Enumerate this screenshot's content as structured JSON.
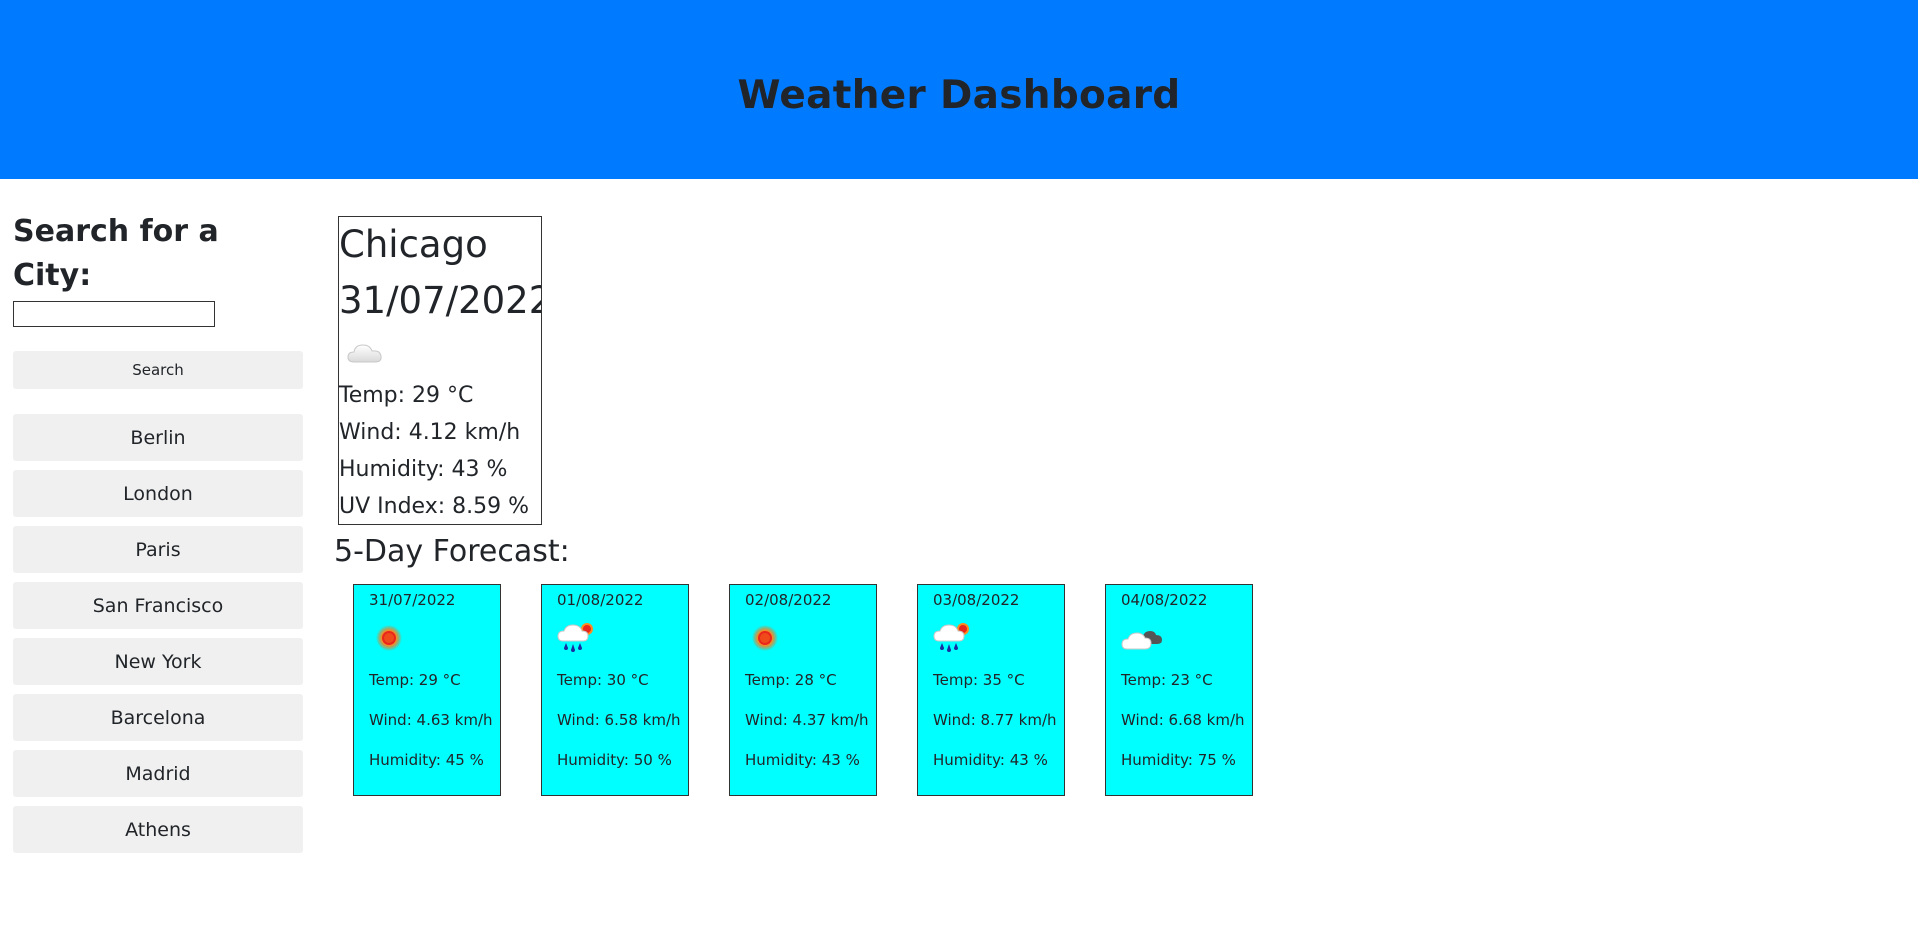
{
  "header": {
    "title": "Weather Dashboard"
  },
  "sidebar": {
    "heading": "Search for a City:",
    "search_value": "",
    "search_button": "Search",
    "history": [
      "Berlin",
      "London",
      "Paris",
      "San Francisco",
      "New York",
      "Barcelona",
      "Madrid",
      "Athens"
    ]
  },
  "current": {
    "city": "Chicago",
    "date": "31/07/2022",
    "icon": "cloud-icon",
    "temp": "Temp: 29 °C",
    "wind": "Wind: 4.12 km/h",
    "humidity": "Humidity: 43 %",
    "uv": "UV Index: 8.59 %"
  },
  "forecast": {
    "title": "5-Day Forecast:",
    "days": [
      {
        "date": "31/07/2022",
        "icon": "sun-icon",
        "temp": "Temp: 29 °C",
        "wind": "Wind: 4.63 km/h",
        "humidity": "Humidity: 45 %"
      },
      {
        "date": "01/08/2022",
        "icon": "rain-sun-icon",
        "temp": "Temp: 30 °C",
        "wind": "Wind: 6.58 km/h",
        "humidity": "Humidity: 50 %"
      },
      {
        "date": "02/08/2022",
        "icon": "sun-icon",
        "temp": "Temp: 28 °C",
        "wind": "Wind: 4.37 km/h",
        "humidity": "Humidity: 43 %"
      },
      {
        "date": "03/08/2022",
        "icon": "rain-sun-icon",
        "temp": "Temp: 35 °C",
        "wind": "Wind: 8.77 km/h",
        "humidity": "Humidity: 43 %"
      },
      {
        "date": "04/08/2022",
        "icon": "cloudy-icon",
        "temp": "Temp: 23 °C",
        "wind": "Wind: 6.68 km/h",
        "humidity": "Humidity: 75 %"
      }
    ]
  },
  "colors": {
    "header_bg": "#007bff",
    "card_bg": "#00ffff",
    "button_bg": "#f0f0f0"
  }
}
